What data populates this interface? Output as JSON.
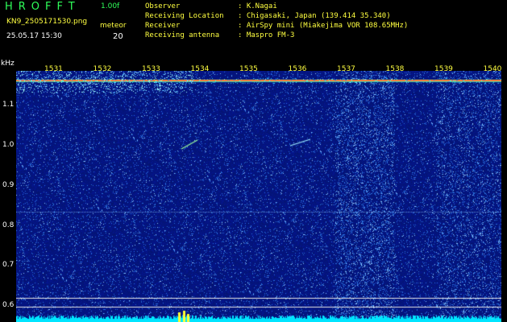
{
  "header": {
    "app_title": "HROFFT",
    "version": "1.00f",
    "filename": "KN9_2505171530.png",
    "timestamp": "25.05.17 15:30",
    "meteor_label": "meteor",
    "meteor_count": "20"
  },
  "info": {
    "observer_key": "Observer",
    "observer_val": ": K.Nagai",
    "location_key": "Receiving Location",
    "location_val": ": Chigasaki, Japan (139.414 35.340)",
    "receiver_key": "Receiver",
    "receiver_val": ": AirSpy mini (Miakejima VOR 108.65MHz)",
    "antenna_key": "Receiving antenna",
    "antenna_val": ": Maspro FM-3"
  },
  "axes": {
    "y_unit": "kHz",
    "x_ticks": [
      "1531",
      "1532",
      "1533",
      "1534",
      "1535",
      "1536",
      "1537",
      "1538",
      "1539",
      "1540"
    ],
    "y_ticks": [
      "1.1",
      "1.0",
      "0.9",
      "0.8",
      "0.7",
      "0.6"
    ]
  },
  "colors": {
    "background": "#000000",
    "info_text": "#ffff40",
    "title_text": "#2fff5a",
    "spectrum_base": "#0a1a8a",
    "carrier": "#ff3030",
    "noise_floor": "#00e5ff"
  }
}
